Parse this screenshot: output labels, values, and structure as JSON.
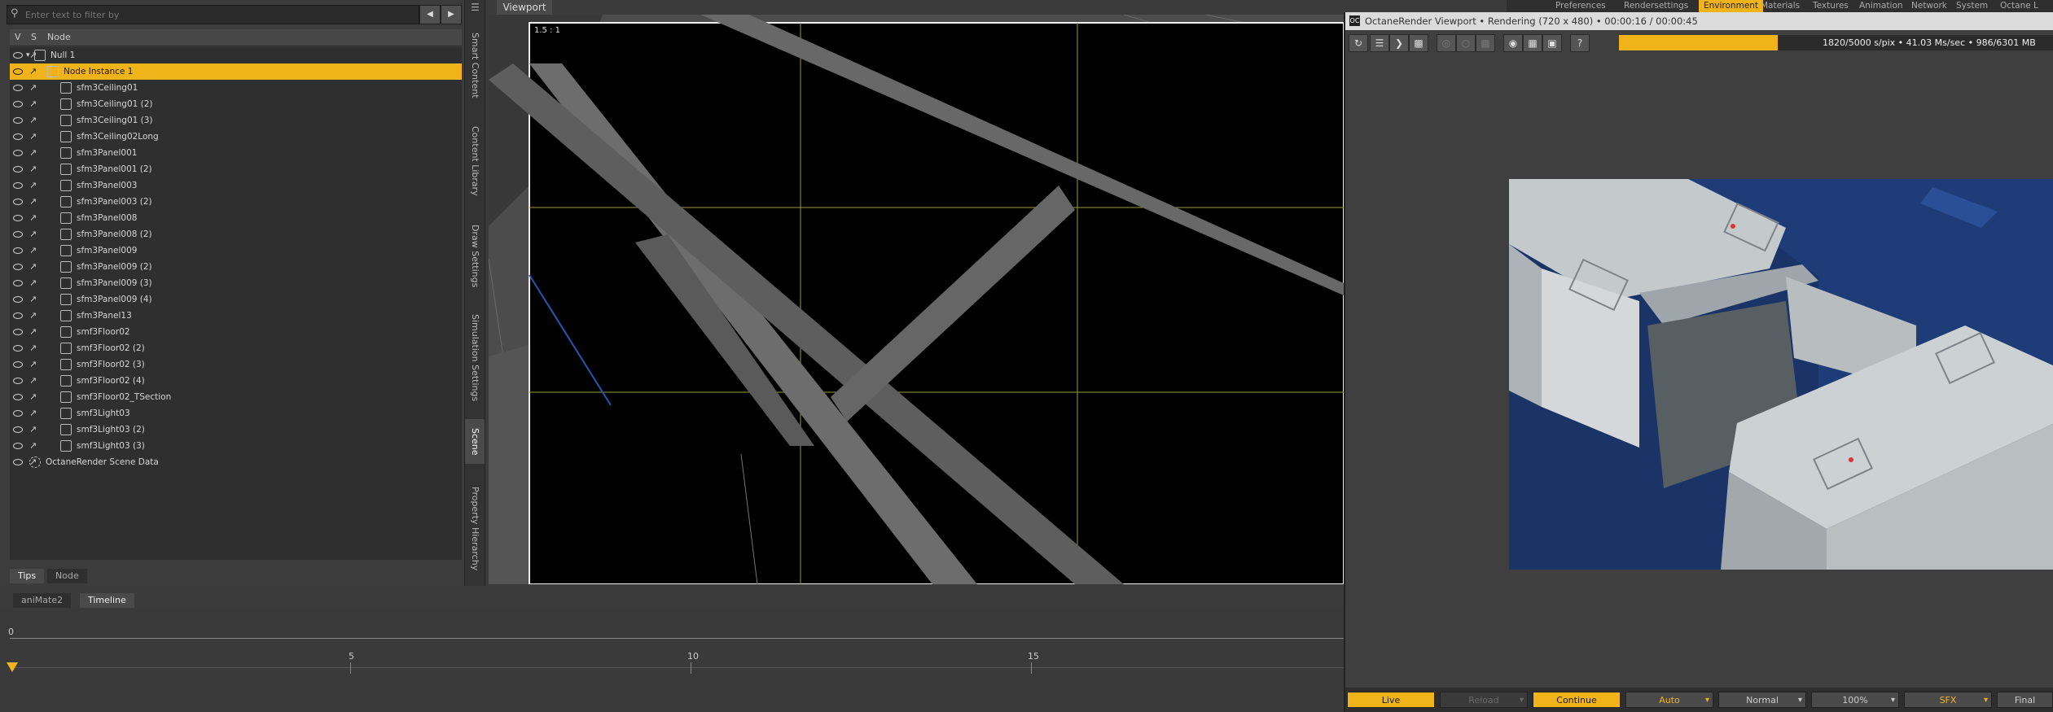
{
  "scene": {
    "filter_placeholder": "Enter text to filter by",
    "header": {
      "v": "V",
      "s": "S",
      "node": "Node"
    },
    "rows": [
      {
        "label": "Null 1"
      },
      {
        "label": "Node Instance 1"
      },
      {
        "label": "sfm3Ceiling01"
      },
      {
        "label": "sfm3Ceiling01 (2)"
      },
      {
        "label": "sfm3Ceiling01 (3)"
      },
      {
        "label": "sfm3Ceiling02Long"
      },
      {
        "label": "sfm3Panel001"
      },
      {
        "label": "sfm3Panel001 (2)"
      },
      {
        "label": "sfm3Panel003"
      },
      {
        "label": "sfm3Panel003 (2)"
      },
      {
        "label": "sfm3Panel008"
      },
      {
        "label": "sfm3Panel008 (2)"
      },
      {
        "label": "sfm3Panel009"
      },
      {
        "label": "sfm3Panel009 (2)"
      },
      {
        "label": "sfm3Panel009 (3)"
      },
      {
        "label": "sfm3Panel009 (4)"
      },
      {
        "label": "sfm3Panel13"
      },
      {
        "label": "smf3Floor02"
      },
      {
        "label": "smf3Floor02 (2)"
      },
      {
        "label": "smf3Floor02 (3)"
      },
      {
        "label": "smf3Floor02 (4)"
      },
      {
        "label": "smf3Floor02_TSection"
      },
      {
        "label": "smf3Light03"
      },
      {
        "label": "smf3Light03 (2)"
      },
      {
        "label": "smf3Light03 (3)"
      },
      {
        "label": "OctaneRender Scene Data"
      }
    ],
    "bottom_tabs": [
      "Tips",
      "Node"
    ]
  },
  "side_tabs": [
    "Smart Content",
    "Content Library",
    "Draw Settings",
    "Simulation Settings",
    "Scene",
    "Property Hierarchy"
  ],
  "viewport": {
    "tab": "Viewport",
    "ratio": "1.5 : 1"
  },
  "anim_tabs": [
    "aniMate2",
    "Timeline"
  ],
  "timeline": {
    "ticks": [
      "0",
      "5",
      "10",
      "15"
    ]
  },
  "top_tabs": [
    "Preferences",
    "Rendersettings",
    "Environment",
    "Materials",
    "Textures",
    "Animation",
    "Network",
    "System",
    "Octane L"
  ],
  "octane": {
    "title": "OctaneRender Viewport • Rendering (720 x 480) • 00:00:16 / 00:00:45",
    "progress_text": "1820/5000 s/pix • 41.03 Ms/sec • 986/6301 MB",
    "progress_fraction": 0.364,
    "buttons": {
      "live": "Live",
      "reload": "Reload",
      "continue": "Continue",
      "auto": "Auto",
      "normal": "Normal",
      "zoom": "100%",
      "sfx": "SFX",
      "final": "Final"
    }
  },
  "colors": {
    "accent": "#f0b31a",
    "render_bg": "#1e3d78"
  }
}
